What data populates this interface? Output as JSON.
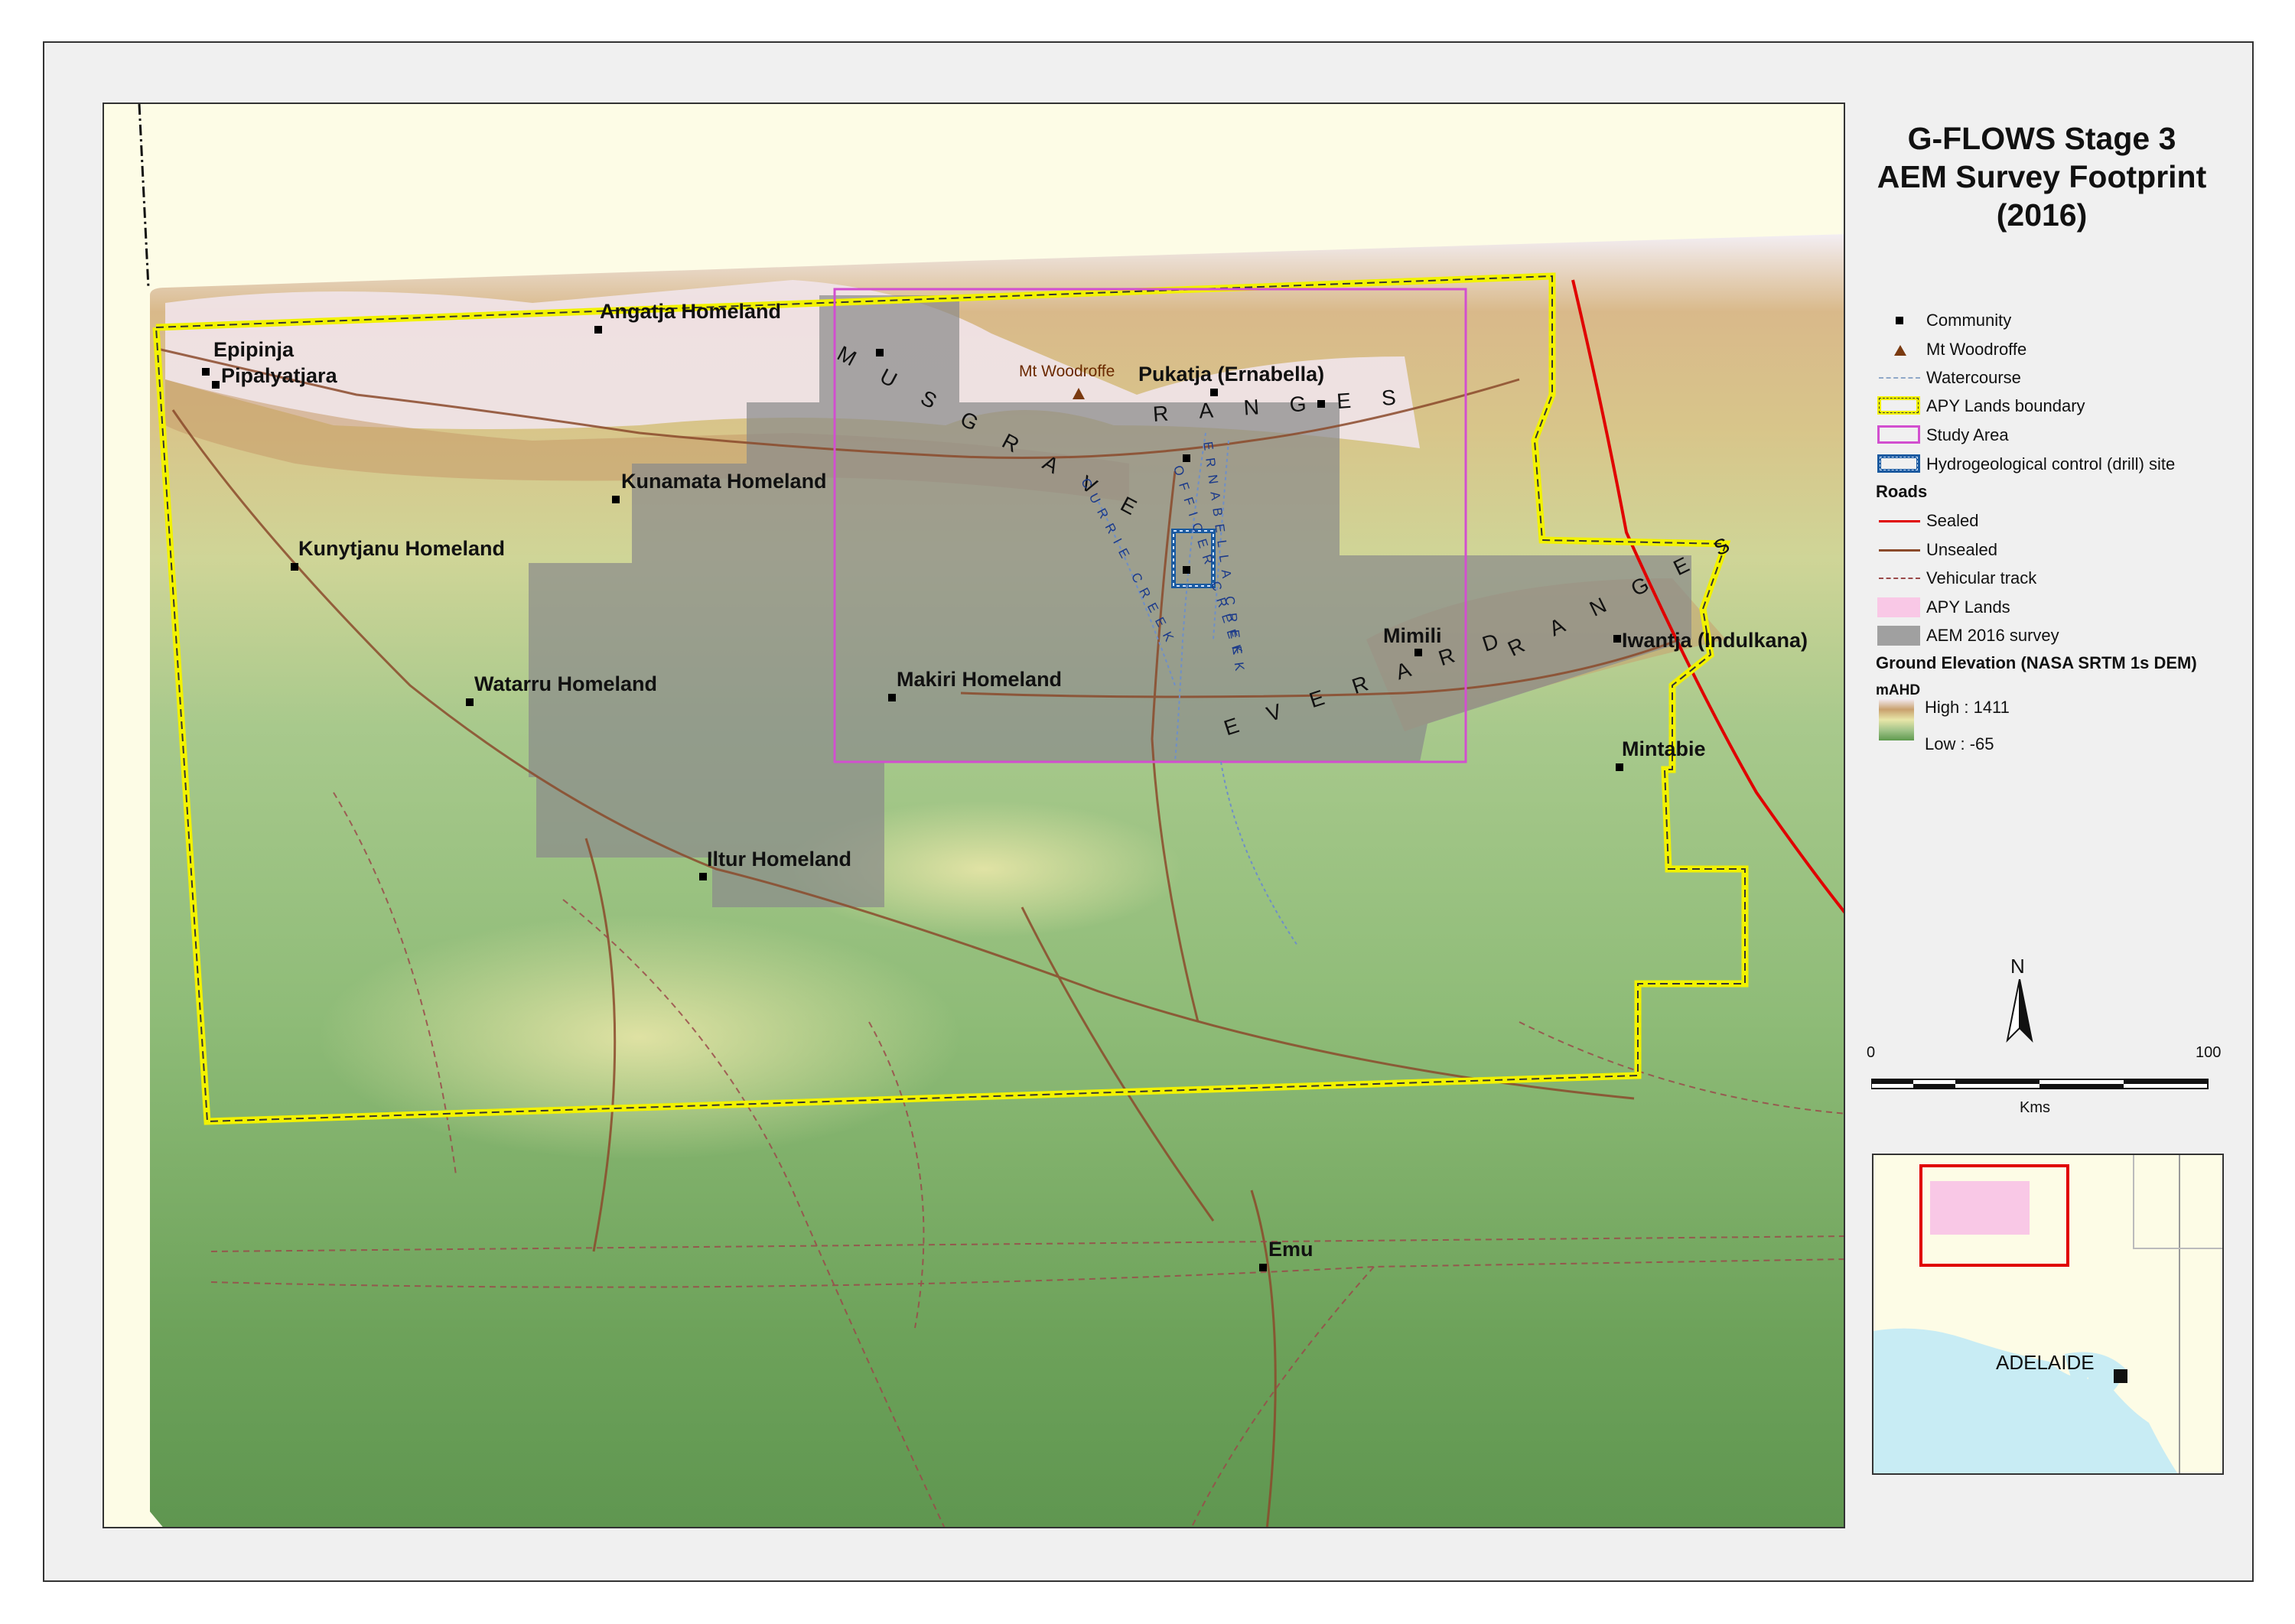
{
  "title": {
    "line1": "G-FLOWS Stage 3",
    "line2": "AEM Survey Footprint",
    "line3": "(2016)"
  },
  "legend": {
    "items": [
      {
        "label": "Community",
        "icon": "square-marker"
      },
      {
        "label": "Mt Woodroffe",
        "icon": "triangle-marker",
        "color": "#7a3a10"
      },
      {
        "label": "Watercourse",
        "icon": "dashed-line",
        "color": "#8fa8c8"
      },
      {
        "label": "APY Lands boundary",
        "icon": "yellow-box",
        "color": "#f2f200"
      },
      {
        "label": "Study Area",
        "icon": "magenta-box",
        "color": "#d24fcf"
      },
      {
        "label": "Hydrogeological control (drill) site",
        "icon": "blue-box",
        "color": "#1a5aa0"
      }
    ],
    "roads_heading": "Roads",
    "roads": [
      {
        "label": "Sealed",
        "color": "#e00000"
      },
      {
        "label": "Unsealed",
        "color": "#8b4a2b"
      },
      {
        "label": "Vehicular track",
        "color": "#9a4a4a"
      }
    ],
    "areas": [
      {
        "label": "APY Lands",
        "color": "#f9c8e6"
      },
      {
        "label": "AEM 2016 survey",
        "color": "#a0a0a0"
      }
    ],
    "elevation_heading": "Ground Elevation (NASA SRTM 1s DEM)",
    "elevation_unit": "mAHD",
    "elevation_high": "High : 1411",
    "elevation_low": "Low : -65"
  },
  "north_arrow": "N",
  "scale": {
    "start": "0",
    "end": "100",
    "unit": "Kms"
  },
  "places": {
    "angatja": "Angatja Homeland",
    "epipinja": "Epipinja",
    "pipalyatjara": "Pipalyatjara",
    "kunamata": "Kunamata Homeland",
    "kunytjanu": "Kunytjanu Homeland",
    "watarru": "Watarru Homeland",
    "makiri": "Makiri Homeland",
    "iltur": "Iltur Homeland",
    "pukatja": "Pukatja (Ernabella)",
    "mimili": "Mimili",
    "iwantja": "Iwantja (Indulkana)",
    "mintabie": "Mintabie",
    "emu": "Emu",
    "mt_woodroffe": "Mt Woodroffe"
  },
  "features": {
    "musgrave_1": "MUSGRAVE",
    "musgrave_2": "RANGES",
    "everard_1": "EVERARD",
    "everard_2": "RANGES",
    "ernabella_creek": "ERNABELLA CREEK",
    "officer_creek": "OFFICER CREEK",
    "currie_creek": "CURRIE CREEK"
  },
  "inset": {
    "city": "ADELAIDE"
  }
}
